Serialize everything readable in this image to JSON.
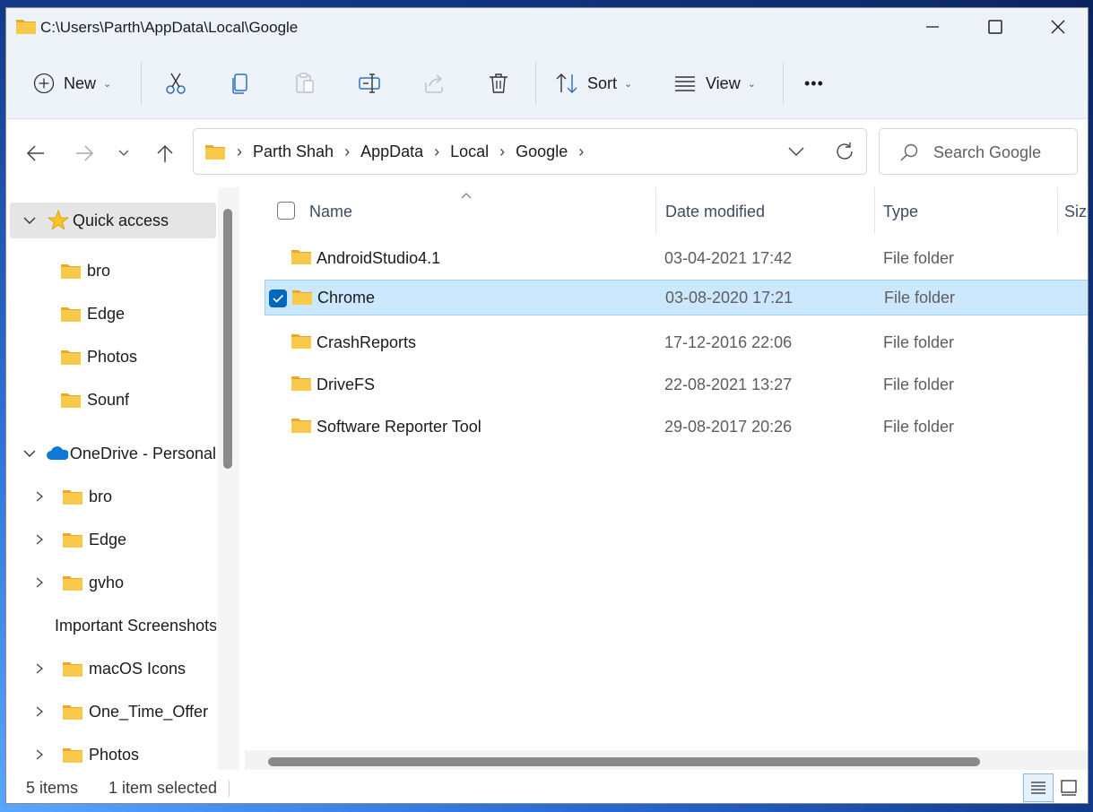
{
  "window": {
    "title": "C:\\Users\\Parth\\AppData\\Local\\Google"
  },
  "toolbar": {
    "new_label": "New",
    "sort_label": "Sort",
    "view_label": "View",
    "more_label": "•••"
  },
  "address": {
    "crumbs": [
      "Parth Shah",
      "AppData",
      "Local",
      "Google"
    ]
  },
  "search": {
    "placeholder": "Search Google"
  },
  "nav": {
    "quick_access": "Quick access",
    "quick_items": [
      "bro",
      "Edge",
      "Photos",
      "Sounf"
    ],
    "onedrive": "OneDrive - Personal",
    "onedrive_items": [
      "bro",
      "Edge",
      "gvho",
      "Important Screenshots",
      "macOS Icons",
      "One_Time_Offer",
      "Photos"
    ]
  },
  "columns": {
    "name": "Name",
    "date": "Date modified",
    "type": "Type",
    "size": "Size"
  },
  "files": [
    {
      "name": "AndroidStudio4.1",
      "date": "03-04-2021 17:42",
      "type": "File folder",
      "selected": false
    },
    {
      "name": "Chrome",
      "date": "03-08-2020 17:21",
      "type": "File folder",
      "selected": true
    },
    {
      "name": "CrashReports",
      "date": "17-12-2016 22:06",
      "type": "File folder",
      "selected": false
    },
    {
      "name": "DriveFS",
      "date": "22-08-2021 13:27",
      "type": "File folder",
      "selected": false
    },
    {
      "name": "Software Reporter Tool",
      "date": "29-08-2017 20:26",
      "type": "File folder",
      "selected": false
    }
  ],
  "status": {
    "count": "5 items",
    "selection": "1 item selected"
  },
  "colors": {
    "folder": "#f8c94a",
    "folder_dark": "#e8a92a",
    "selection": "#cce8ff",
    "accent": "#0067c0"
  },
  "icons": [
    "folder-icon",
    "add-icon",
    "cut-icon",
    "copy-icon",
    "paste-icon",
    "rename-icon",
    "share-icon",
    "delete-icon",
    "sort-icon",
    "view-icon",
    "more-icon",
    "back-icon",
    "forward-icon",
    "recent-icon",
    "up-icon",
    "refresh-icon",
    "search-icon",
    "star-icon",
    "cloud-icon",
    "chevron-icon",
    "details-view-icon",
    "tiles-view-icon"
  ]
}
